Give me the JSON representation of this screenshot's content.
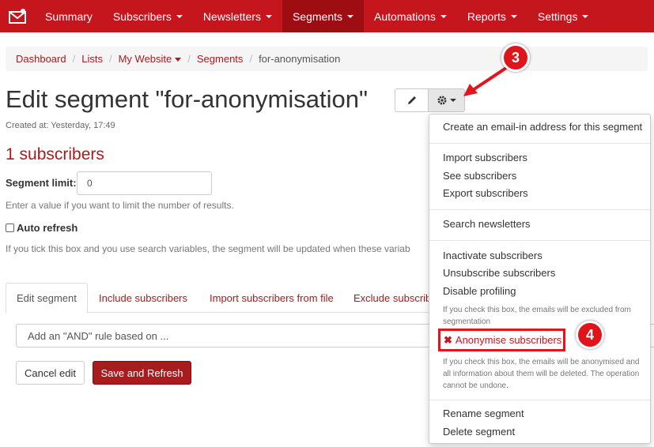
{
  "nav": {
    "items": [
      {
        "label": "Summary",
        "has_caret": false
      },
      {
        "label": "Subscribers",
        "has_caret": true
      },
      {
        "label": "Newsletters",
        "has_caret": true
      },
      {
        "label": "Segments",
        "has_caret": true,
        "active": true
      },
      {
        "label": "Automations",
        "has_caret": true
      },
      {
        "label": "Reports",
        "has_caret": true
      },
      {
        "label": "Settings",
        "has_caret": true
      }
    ],
    "brand_icon": "envelope-logo-icon"
  },
  "breadcrumb": {
    "dashboard": "Dashboard",
    "lists": "Lists",
    "my_website": "My Website",
    "segments": "Segments",
    "current": "for-anonymisation"
  },
  "header": {
    "title": "Edit segment \"for-anonymisation\"",
    "created_at": "Created at: Yesterday, 17:49",
    "edit_icon": "pencil-icon",
    "settings_icon": "gear-icon"
  },
  "summary": {
    "subscribers": "1 subscribers"
  },
  "segment_limit": {
    "label": "Segment limit:",
    "value": "0",
    "help": "Enter a value if you want to limit the number of results."
  },
  "auto_refresh": {
    "label": "Auto refresh",
    "checked": false,
    "help": "If you tick this box and you use search variables, the segment will be updated when these variab"
  },
  "tabs": [
    {
      "label": "Edit segment",
      "active": true
    },
    {
      "label": "Include subscribers"
    },
    {
      "label": "Import subscribers from file"
    },
    {
      "label": "Exclude subscrib"
    }
  ],
  "rule": {
    "text": "Add an \"AND\" rule based on ..."
  },
  "actions": {
    "cancel": "Cancel edit",
    "save": "Save and Refresh"
  },
  "dropdown": {
    "create_email_in": "Create an email-in address for this segment",
    "import": "Import subscribers",
    "see": "See subscribers",
    "export": "Export subscribers",
    "search_newsletters": "Search newsletters",
    "inactivate": "Inactivate subscribers",
    "unsubscribe": "Unsubscribe subscribers",
    "disable_profiling": "Disable profiling",
    "disable_profiling_help": "If you check this box, the emails will be excluded from segmentation",
    "anonymise": "Anonymise subscribers",
    "anonymise_help": "If you check this box, the emails will be anonymised and all information about them will be deleted. The operation cannot be undone.",
    "rename": "Rename segment",
    "delete": "Delete segment"
  },
  "callouts": {
    "step3": "3",
    "step4": "4"
  },
  "colors": {
    "brand": "#c4161c",
    "brand_dark": "#9d0d12",
    "link": "#a81b1f",
    "highlight": "#e3141b"
  }
}
